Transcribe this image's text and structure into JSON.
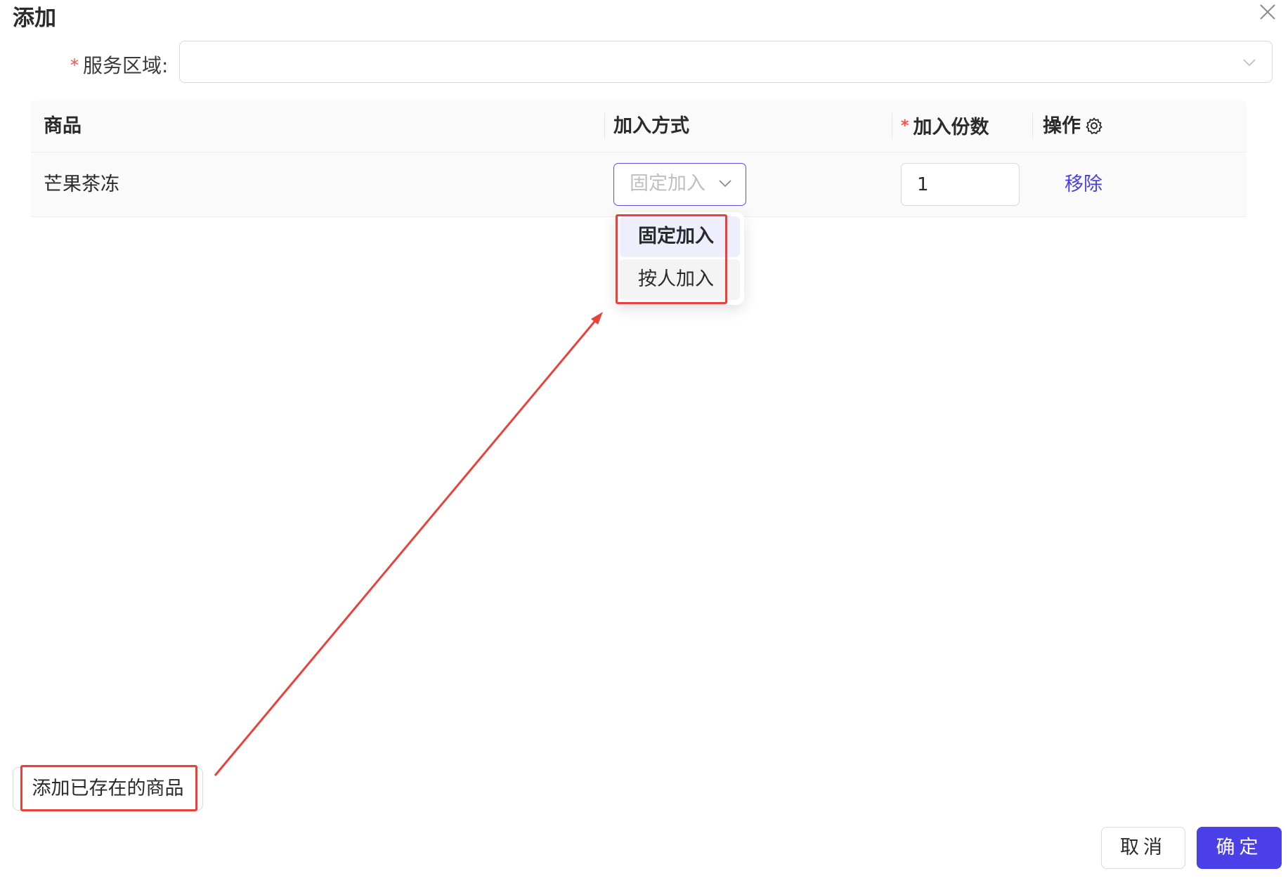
{
  "modal": {
    "title": "添加"
  },
  "form": {
    "region_label": "服务区域:",
    "region_required_mark": "*",
    "region_value": ""
  },
  "table": {
    "columns": {
      "product": "商品",
      "mode": "加入方式",
      "qty_required_mark": "*",
      "qty": "加入份数",
      "action": "操作"
    },
    "rows": [
      {
        "product": "芒果茶冻",
        "mode_placeholder": "固定加入",
        "qty": "1",
        "action": "移除"
      }
    ]
  },
  "dropdown": {
    "options": [
      {
        "label": "固定加入",
        "selected": true
      },
      {
        "label": "按人加入",
        "selected": false
      }
    ]
  },
  "footer": {
    "add_existing_label": "添加已存在的商品",
    "cancel_label": "取消",
    "ok_label": "确定"
  },
  "colors": {
    "primary": "#4b3fe8",
    "link": "#4b3fe0",
    "required": "#ff4d4f",
    "annotation": "#e8433a"
  },
  "icons": {
    "close": "close-icon",
    "chevron": "chevron-down-icon",
    "settings": "gear-icon"
  }
}
